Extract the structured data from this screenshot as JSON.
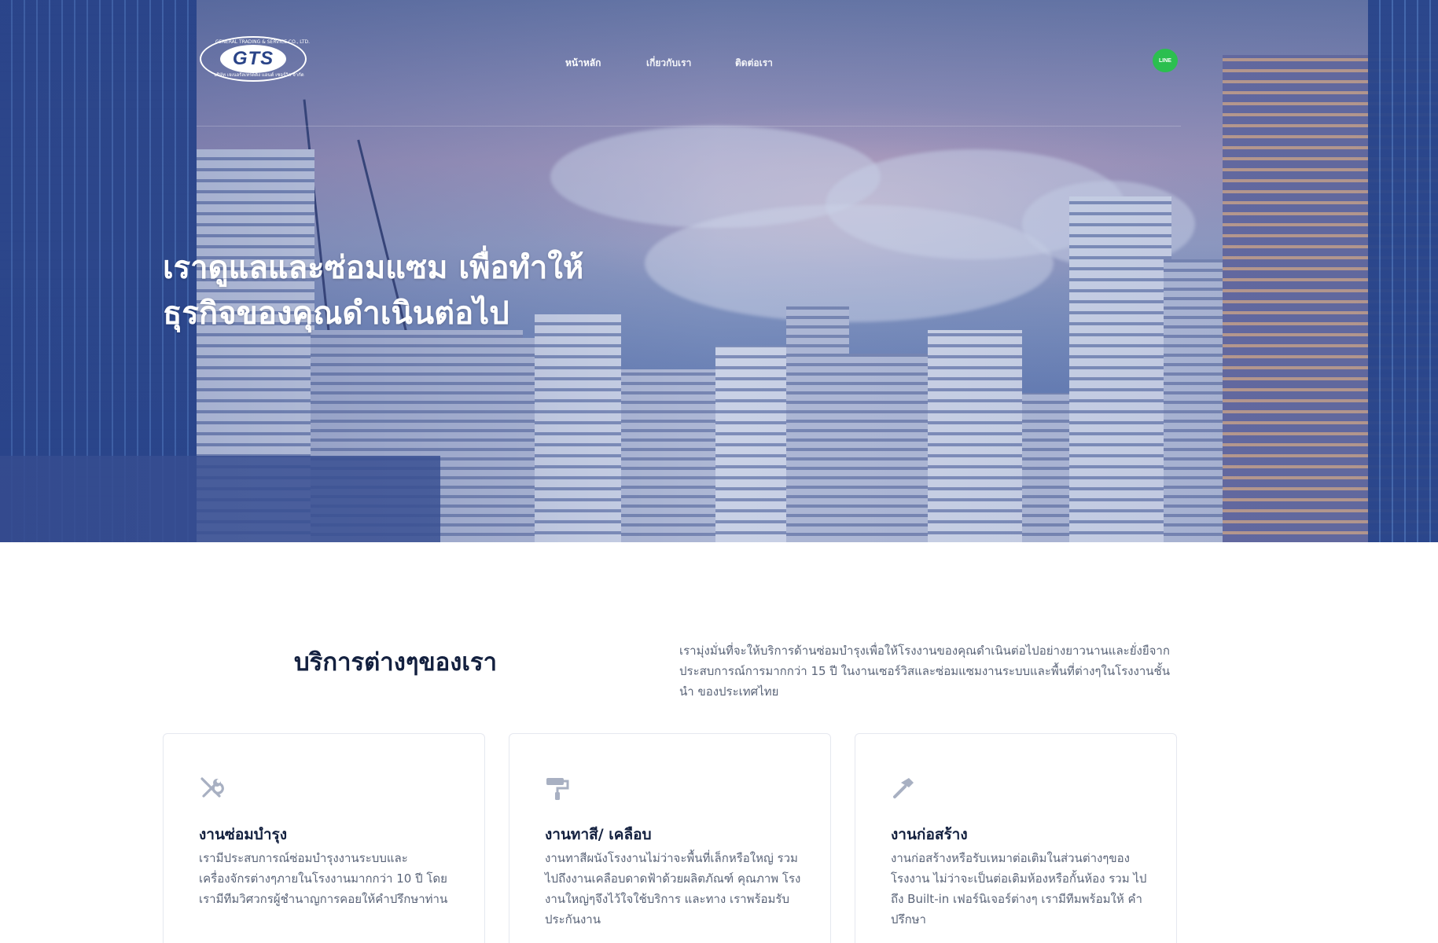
{
  "brand": {
    "logo_text": "GTS",
    "logo_arc_top": "GENERAL TRADING & SERVICE CO., LTD.",
    "logo_arc_bottom": "บริษัท เจเนอรัลเทรดดิ้ง แอนด์ เซอร์วิส จำกัด"
  },
  "nav": {
    "items": [
      {
        "label": "หน้าหลัก"
      },
      {
        "label": "เกี่ยวกับเรา"
      },
      {
        "label": "ติดต่อเรา"
      }
    ],
    "line_button_label": "LINE"
  },
  "hero": {
    "title": "เราดูแลและซ่อมแซม เพื่อทำให้ธุรกิจของคุณดำเนินต่อไป"
  },
  "services": {
    "heading": "บริการต่างๆของเรา",
    "intro": "เรามุ่งมั่นที่จะให้บริการด้านซ่อมบำรุงเพื่อให้โรงงานของคุณดำเนินต่อไปอย่างยาวนานและยั่งยืจาก ประสบการณ์การมากกว่า 15 ปี ในงานเซอร์วิสและซ่อมแซมงานระบบและพื้นที่ต่างๆในโรงงานชั้นนำ ของประเทศไทย",
    "cards": [
      {
        "icon": "tools-icon",
        "title": "งานซ่อมบำรุง",
        "text": "เรามีประสบการณ์ซ่อมบำรุงงานระบบและ เครื่องจักรต่างๆภายในโรงงานมากกว่า 10 ปี โดย เรามีทีมวิศวกรผู้ชำนาญการคอยให้คำปรึกษาท่าน"
      },
      {
        "icon": "paint-roller-icon",
        "title": "งานทาสี/ เคลือบ",
        "text": "งานทาสีผนังโรงงานไม่ว่าจะพื้นที่เล็กหรือใหญ่ รวมไปถึงงานเคลือบดาดฟ้าด้วยผลิตภัณฑ์ คุณภาพ โรงงานใหญ่ๆจึงไว้ใจใช้บริการ และทาง เราพร้อมรับประกันงาน"
      },
      {
        "icon": "hammer-icon",
        "title": "งานก่อสร้าง",
        "text": "งานก่อสร้างหรือรับเหมาต่อเติมในส่วนต่างๆของ โรงงาน ไม่ว่าจะเป็นต่อเติมห้องหรือกั้นห้อง รวม ไปถึง Built-in เฟอร์นิเจอร์ต่างๆ เรามีทีมพร้อมให้ คำปรึกษา"
      }
    ]
  }
}
